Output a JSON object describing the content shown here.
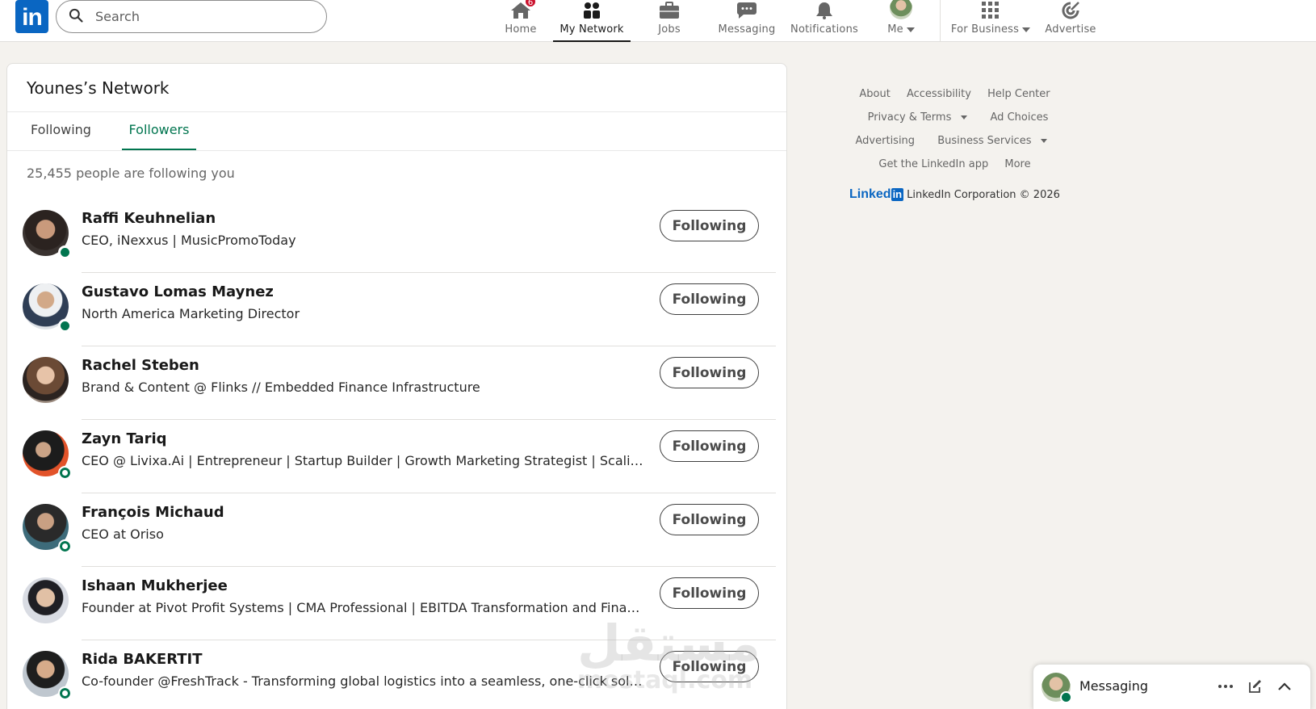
{
  "nav": {
    "logo": "in",
    "search_placeholder": "Search",
    "items": [
      {
        "label": "Home",
        "badge": "6"
      },
      {
        "label": "My Network"
      },
      {
        "label": "Jobs"
      },
      {
        "label": "Messaging"
      },
      {
        "label": "Notifications"
      },
      {
        "label": "Me"
      },
      {
        "label": "For Business"
      },
      {
        "label": "Advertise"
      }
    ]
  },
  "network": {
    "title": "Younes’s Network",
    "tabs": [
      {
        "label": "Following"
      },
      {
        "label": "Followers",
        "active": true
      }
    ],
    "count_text": "25,455 people are following you",
    "people": [
      {
        "name": "Raffi Keuhnelian",
        "headline": "CEO, iNexxus | MusicPromoToday",
        "button": "Following"
      },
      {
        "name": "Gustavo Lomas Maynez",
        "headline": "North America Marketing Director",
        "button": "Following"
      },
      {
        "name": "Rachel Steben",
        "headline": "Brand & Content @ Flinks // Embedded Finance Infrastructure",
        "button": "Following"
      },
      {
        "name": "Zayn Tariq",
        "headline": "CEO @ Livixa.Ai | Entrepreneur | Startup Builder | Growth Marketing Strategist | Scaling Bran...",
        "button": "Following"
      },
      {
        "name": "François Michaud",
        "headline": "CEO at Oriso",
        "button": "Following"
      },
      {
        "name": "Ishaan Mukherjee",
        "headline": "Founder at Pivot Profit Systems | CMA Professional | EBITDA Transformation and Financial...",
        "button": "Following"
      },
      {
        "name": "Rida BAKERTIT",
        "headline": "Co-founder @FreshTrack - Transforming global logistics into a seamless, one-click solution...",
        "button": "Following"
      }
    ]
  },
  "footer": {
    "links": {
      "about": "About",
      "accessibility": "Accessibility",
      "help_center": "Help Center",
      "privacy_terms": "Privacy & Terms",
      "ad_choices": "Ad Choices",
      "advertising": "Advertising",
      "business_services": "Business Services",
      "get_app": "Get the LinkedIn app",
      "more": "More"
    },
    "brand_word": "Linked",
    "brand_box": "in",
    "copyright": "LinkedIn Corporation © 2026"
  },
  "messaging": {
    "label": "Messaging"
  },
  "watermark": {
    "text": "مستقل",
    "sub": "mostaql.com"
  },
  "colors": {
    "brand": "#0a66c2",
    "active_tab": "#01754f",
    "badge": "#cb112d",
    "presence": "#01754f"
  }
}
